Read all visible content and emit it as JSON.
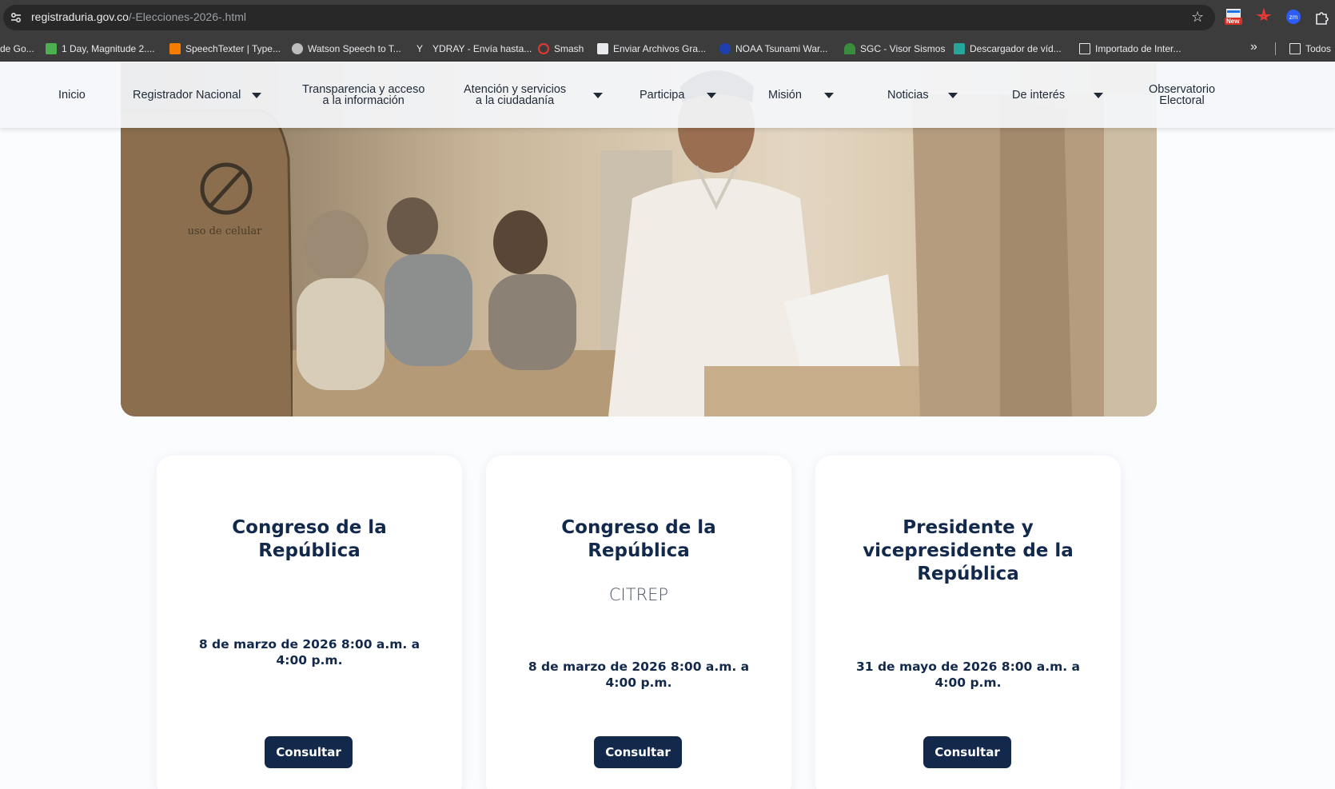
{
  "browser": {
    "url_host": "registraduria.gov.co",
    "url_path": "/-Elecciones-2026-.html",
    "bookmarks": [
      {
        "label": "de Go..."
      },
      {
        "label": "1 Day, Magnitude 2...."
      },
      {
        "label": "SpeechTexter | Type..."
      },
      {
        "label": "Watson Speech to T..."
      },
      {
        "label": "YDRAY - Envía hasta..."
      },
      {
        "label": "Smash"
      },
      {
        "label": "Enviar Archivos Gra..."
      },
      {
        "label": "NOAA Tsunami War..."
      },
      {
        "label": "SGC - Visor Sismos"
      },
      {
        "label": "Descargador de víd..."
      },
      {
        "label": "Importado de Inter..."
      },
      {
        "label": "Todos"
      }
    ],
    "extension_badge": "New"
  },
  "nav": {
    "items": [
      {
        "label": "Inicio"
      },
      {
        "label": "Registrador Nacional"
      },
      {
        "label": "Transparencia y acceso\na la información"
      },
      {
        "label": "Atención y servicios\na la ciudadanía"
      },
      {
        "label": "Participa"
      },
      {
        "label": "Misión"
      },
      {
        "label": "Noticias"
      },
      {
        "label": "De interés"
      },
      {
        "label": "Observatorio\nElectoral"
      }
    ]
  },
  "hero": {
    "sign_text": "uso de celular"
  },
  "cards": [
    {
      "title": "Congreso de la\nRepública",
      "subtitle": "",
      "date": "8 de marzo de 2026 8:00 a.m. a\n4:00 p.m.",
      "button": "Consultar"
    },
    {
      "title": "Congreso de la\nRepública",
      "subtitle": "CITREP",
      "date": "8 de marzo de 2026 8:00 a.m. a\n4:00 p.m.",
      "button": "Consultar"
    },
    {
      "title": "Presidente y\nvicepresidente de la\nRepública",
      "subtitle": "",
      "date": "31 de mayo de 2026 8:00 a.m. a\n4:00 p.m.",
      "button": "Consultar"
    }
  ]
}
